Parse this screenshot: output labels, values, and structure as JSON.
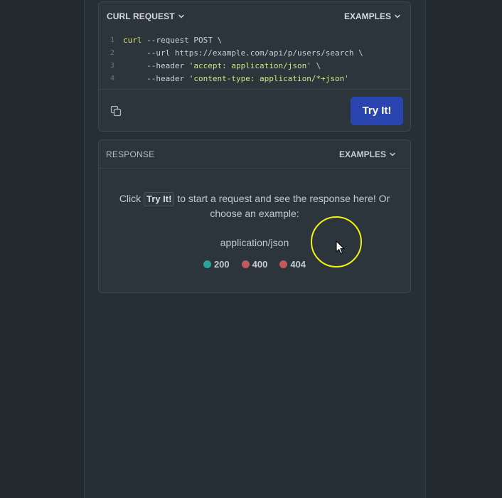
{
  "request": {
    "title": "CURL REQUEST",
    "examples_label": "EXAMPLES",
    "code_lines": [
      {
        "num": "1",
        "parts": [
          {
            "t": "kw",
            "v": "curl"
          },
          {
            "t": "plain",
            "v": " --request POST \\"
          }
        ]
      },
      {
        "num": "2",
        "parts": [
          {
            "t": "plain",
            "v": "     --url https://example.com/api/p/users/search \\"
          }
        ]
      },
      {
        "num": "3",
        "parts": [
          {
            "t": "plain",
            "v": "     --header "
          },
          {
            "t": "str",
            "v": "'accept: application/json'"
          },
          {
            "t": "plain",
            "v": " \\"
          }
        ]
      },
      {
        "num": "4",
        "parts": [
          {
            "t": "plain",
            "v": "     --header "
          },
          {
            "t": "str",
            "v": "'content-type: application/*+json'"
          }
        ]
      }
    ],
    "copy_icon": "copy-icon",
    "try_label": "Try It!"
  },
  "response": {
    "title": "RESPONSE",
    "examples_label": "EXAMPLES",
    "prompt_before": "Click ",
    "prompt_button": "Try It!",
    "prompt_after": " to start a request and see the response here! Or choose an example:",
    "mime": "application/json",
    "codes": [
      {
        "label": "200",
        "color": "#2aa39b"
      },
      {
        "label": "400",
        "color": "#c05a5a"
      },
      {
        "label": "404",
        "color": "#c05a5a"
      }
    ]
  },
  "colors": {
    "accent": "#2a44b0",
    "highlight_ring": "#f2f20e"
  }
}
